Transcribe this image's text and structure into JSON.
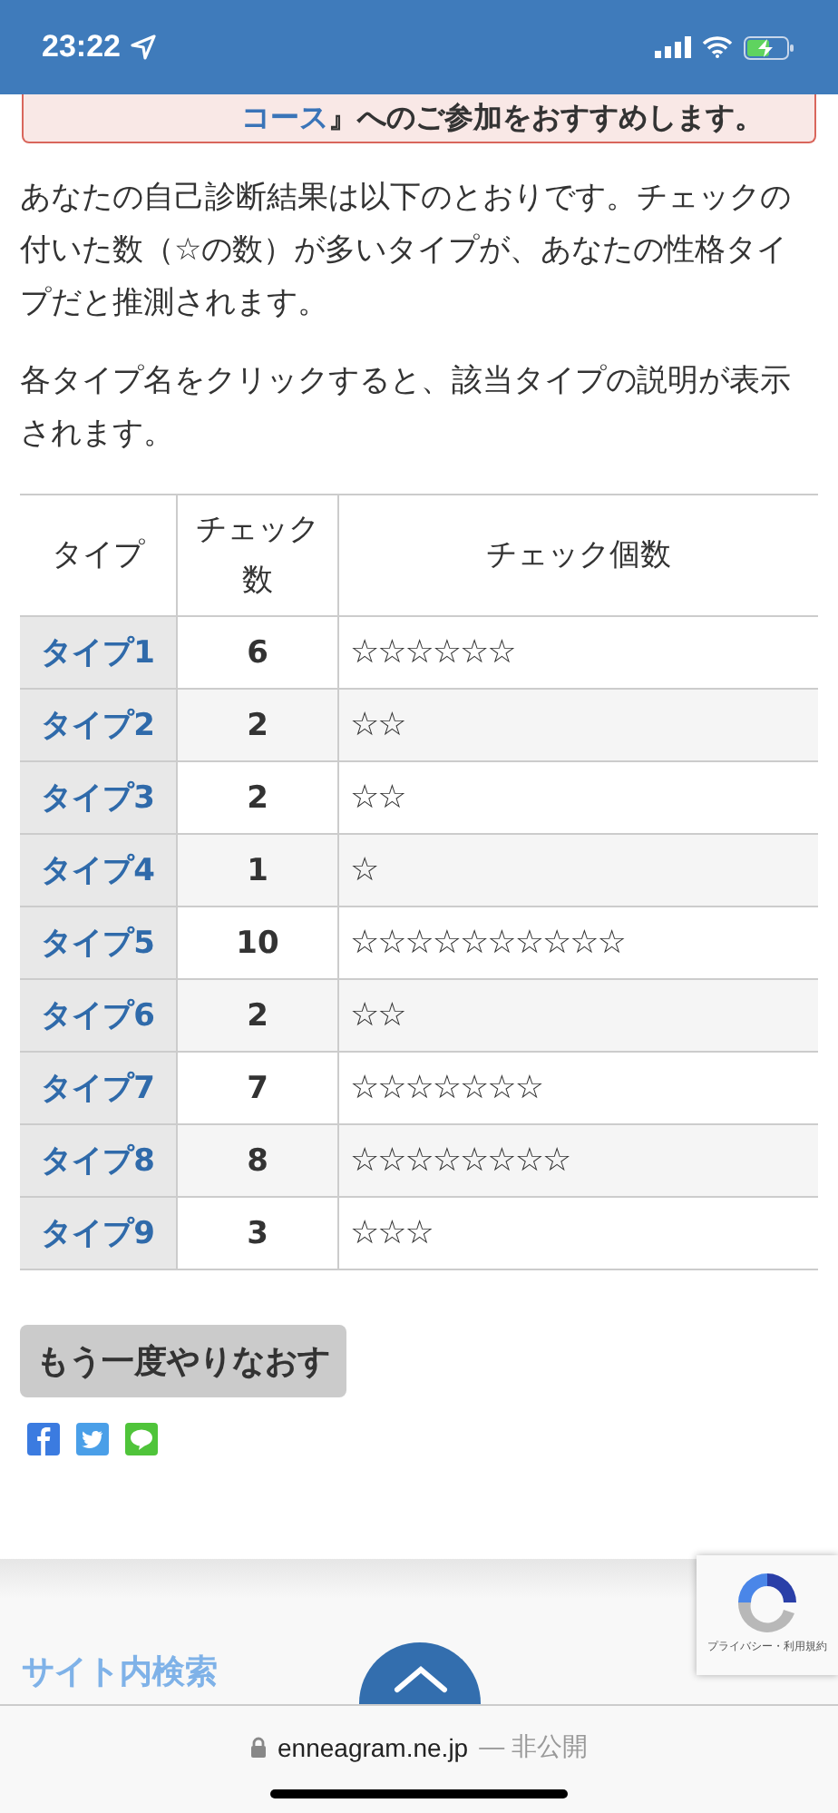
{
  "status_bar": {
    "time": "23:22"
  },
  "notice": {
    "link": "コース",
    "text": "』へのご参加をおすすめします。"
  },
  "intro": [
    "あなたの自己診断結果は以下のとおりです。チェックの付いた数（☆の数）が多いタイプが、あなたの性格タイプだと推測されます。",
    "各タイプ名をクリックすると、該当タイプの説明が表示されます。"
  ],
  "table": {
    "columns": [
      "タイプ",
      "チェック数",
      "チェック個数"
    ],
    "rows": [
      {
        "type": "タイプ1",
        "count": "6",
        "marks": "☆☆☆☆☆☆"
      },
      {
        "type": "タイプ2",
        "count": "2",
        "marks": "☆☆"
      },
      {
        "type": "タイプ3",
        "count": "2",
        "marks": "☆☆"
      },
      {
        "type": "タイプ4",
        "count": "1",
        "marks": "☆"
      },
      {
        "type": "タイプ5",
        "count": "10",
        "marks": "☆☆☆☆☆☆☆☆☆☆"
      },
      {
        "type": "タイプ6",
        "count": "2",
        "marks": "☆☆"
      },
      {
        "type": "タイプ7",
        "count": "7",
        "marks": "☆☆☆☆☆☆☆"
      },
      {
        "type": "タイプ8",
        "count": "8",
        "marks": "☆☆☆☆☆☆☆☆"
      },
      {
        "type": "タイプ9",
        "count": "3",
        "marks": "☆☆☆"
      }
    ]
  },
  "retry_button": "もう一度やりなおす",
  "share": [
    {
      "kind": "facebook"
    },
    {
      "kind": "twitter"
    },
    {
      "kind": "line"
    }
  ],
  "footer": {
    "search_heading": "サイト内検索",
    "recaptcha": "プライバシー・利用規約"
  },
  "browser": {
    "domain": "enneagram.ne.jp",
    "suffix": "— 非公開"
  }
}
